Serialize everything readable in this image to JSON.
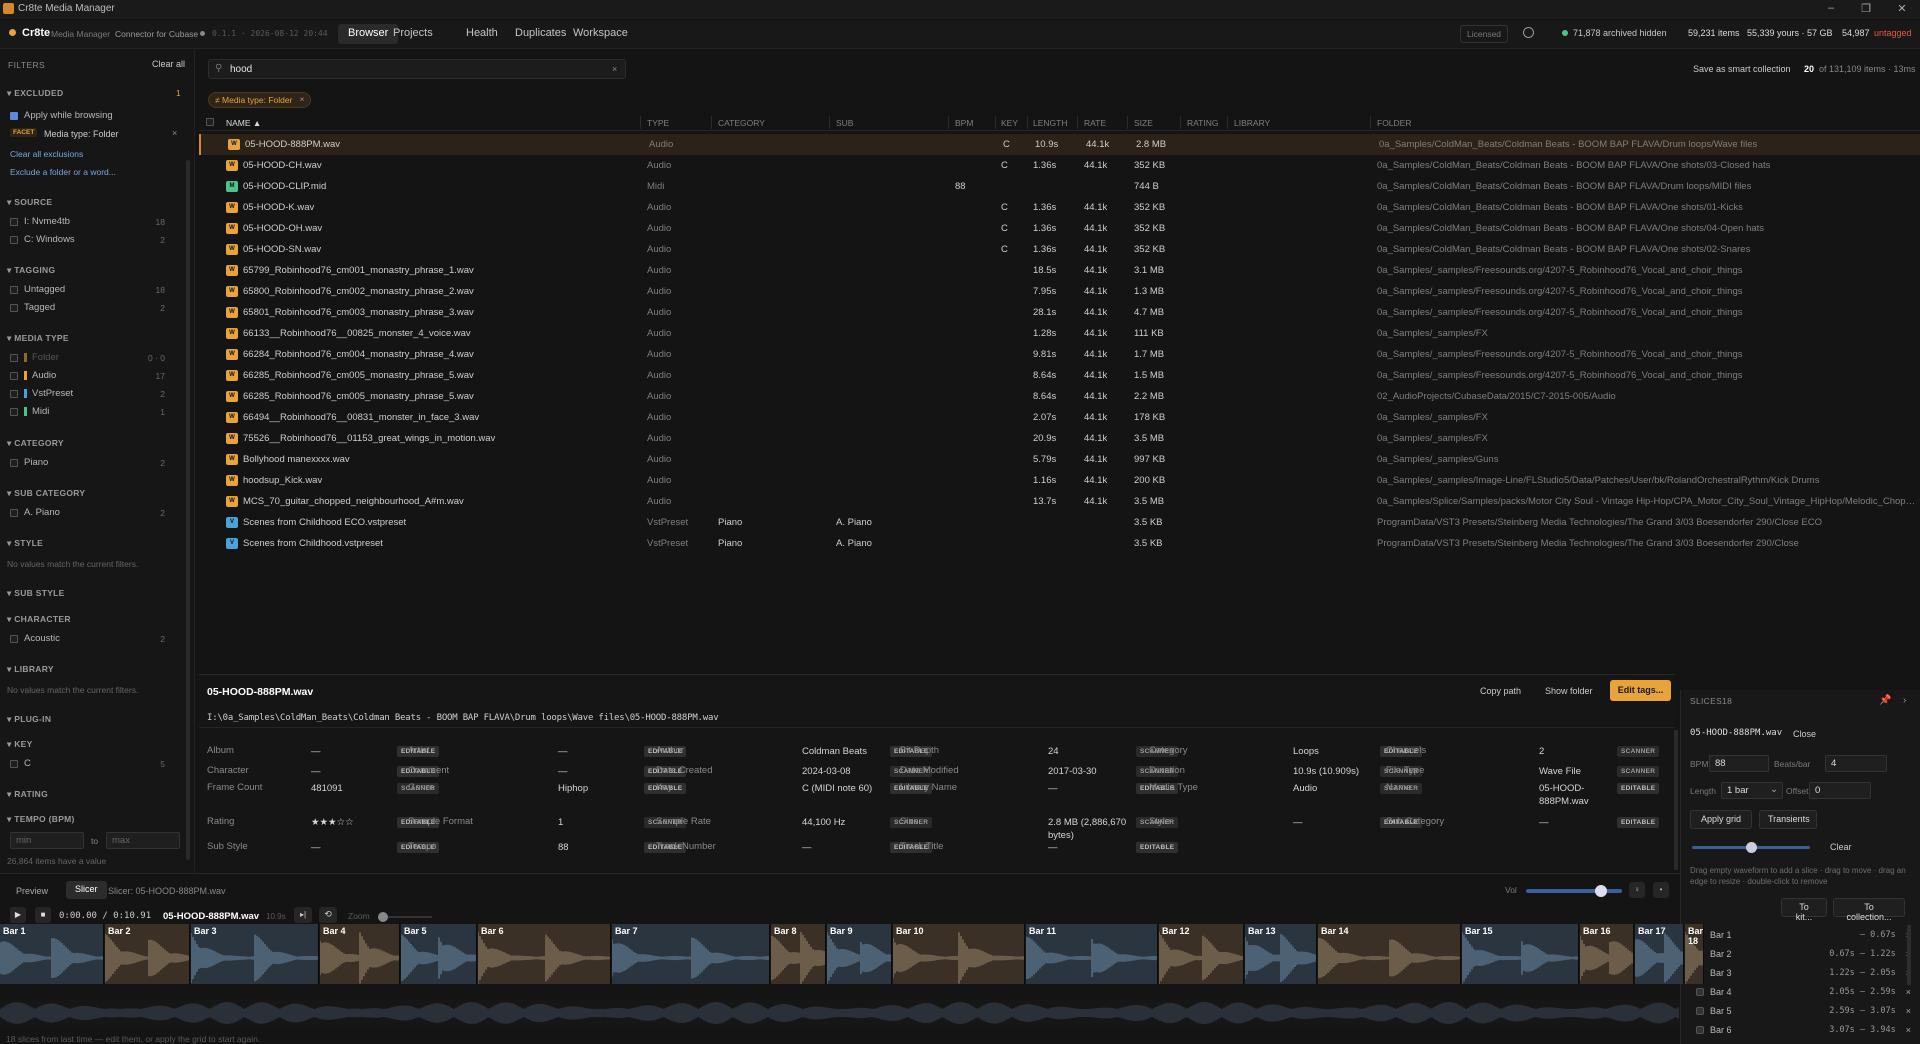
{
  "window": {
    "title": "Cr8te Media Manager"
  },
  "nav": {
    "app": "Cr8te",
    "sub": "Media Manager",
    "connector": "Connector for Cubase",
    "version": "0.1.1 · 2026-08-12 20:44",
    "tabs": [
      "Browser",
      "Projects",
      "Health",
      "Duplicates",
      "Workspace"
    ],
    "licensed": "Licensed",
    "archived": "71,878 archived hidden",
    "items": "59,231 items",
    "yours": "55,339 yours · 57 GB",
    "untagged_count": "54,987",
    "untagged_label": "untagged"
  },
  "filters": {
    "title": "FILTERS",
    "clear_all": "Clear all",
    "excluded": {
      "title": "EXCLUDED",
      "count": "1",
      "apply": "Apply while browsing",
      "facet": "FACET",
      "facet_value": "Media type: Folder",
      "clear": "Clear all exclusions",
      "exclude_hint": "Exclude a folder or a word..."
    },
    "source": {
      "title": "SOURCE",
      "items": [
        {
          "label": "I: Nvme4tb",
          "count": "18"
        },
        {
          "label": "C: Windows",
          "count": "2"
        }
      ]
    },
    "tagging": {
      "title": "TAGGING",
      "items": [
        {
          "label": "Untagged",
          "count": "18"
        },
        {
          "label": "Tagged",
          "count": "2"
        }
      ]
    },
    "media_type": {
      "title": "MEDIA TYPE",
      "items": [
        {
          "label": "Folder",
          "count": "0 · 0",
          "color": "#8a6a2a"
        },
        {
          "label": "Audio",
          "count": "17",
          "color": "#e8a33a"
        },
        {
          "label": "VstPreset",
          "count": "2",
          "color": "#4aa3d8"
        },
        {
          "label": "Midi",
          "count": "1",
          "color": "#4cc38a"
        }
      ]
    },
    "category": {
      "title": "CATEGORY",
      "items": [
        {
          "label": "Piano",
          "count": "2"
        }
      ]
    },
    "sub_category": {
      "title": "SUB CATEGORY",
      "items": [
        {
          "label": "A. Piano",
          "count": "2"
        }
      ]
    },
    "style": {
      "title": "STYLE",
      "empty": "No values match the current filters."
    },
    "sub_style": {
      "title": "SUB STYLE"
    },
    "character": {
      "title": "CHARACTER",
      "items": [
        {
          "label": "Acoustic",
          "count": "2"
        }
      ]
    },
    "library": {
      "title": "LIBRARY",
      "empty": "No values match the current filters."
    },
    "plugin": {
      "title": "PLUG-IN"
    },
    "key": {
      "title": "KEY",
      "items": [
        {
          "label": "C",
          "count": "5"
        }
      ]
    },
    "rating": {
      "title": "RATING"
    },
    "tempo": {
      "title": "TEMPO (BPM)",
      "min": "min",
      "to": "to",
      "max": "max",
      "note": "26,864 items have a value"
    }
  },
  "search": {
    "value": "hood",
    "save": "Save as smart collection",
    "count_a": "20",
    "count_b": "of 131,109 items · 13ms"
  },
  "chip": {
    "label": "≠ Media type: Folder"
  },
  "columns": [
    "Name ▲",
    "Type",
    "Category",
    "Sub",
    "BPM",
    "Key",
    "Length",
    "Rate",
    "Size",
    "Rating",
    "Library",
    "Folder"
  ],
  "rows": [
    {
      "icon": "WAV",
      "c": "#e8a33a",
      "name": "05-HOOD-888PM.wav",
      "type": "Audio",
      "cat": "",
      "sub": "",
      "bpm": "",
      "key": "C",
      "len": "10.9s",
      "rate": "44.1k",
      "size": "2.8 MB",
      "folder": "0a_Samples/ColdMan_Beats/Coldman Beats - BOOM BAP FLAVA/Drum loops/Wave files"
    },
    {
      "icon": "WAV",
      "c": "#e8a33a",
      "name": "05-HOOD-CH.wav",
      "type": "Audio",
      "cat": "",
      "sub": "",
      "bpm": "",
      "key": "C",
      "len": "1.36s",
      "rate": "44.1k",
      "size": "352 KB",
      "folder": "0a_Samples/ColdMan_Beats/Coldman Beats - BOOM BAP FLAVA/One shots/03-Closed hats"
    },
    {
      "icon": "MID",
      "c": "#4cc38a",
      "name": "05-HOOD-CLIP.mid",
      "type": "Midi",
      "cat": "",
      "sub": "",
      "bpm": "88",
      "key": "",
      "len": "",
      "rate": "",
      "size": "744 B",
      "folder": "0a_Samples/ColdMan_Beats/Coldman Beats - BOOM BAP FLAVA/Drum loops/MIDI files"
    },
    {
      "icon": "WAV",
      "c": "#e8a33a",
      "name": "05-HOOD-K.wav",
      "type": "Audio",
      "cat": "",
      "sub": "",
      "bpm": "",
      "key": "C",
      "len": "1.36s",
      "rate": "44.1k",
      "size": "352 KB",
      "folder": "0a_Samples/ColdMan_Beats/Coldman Beats - BOOM BAP FLAVA/One shots/01-Kicks"
    },
    {
      "icon": "WAV",
      "c": "#e8a33a",
      "name": "05-HOOD-OH.wav",
      "type": "Audio",
      "cat": "",
      "sub": "",
      "bpm": "",
      "key": "C",
      "len": "1.36s",
      "rate": "44.1k",
      "size": "352 KB",
      "folder": "0a_Samples/ColdMan_Beats/Coldman Beats - BOOM BAP FLAVA/One shots/04-Open hats"
    },
    {
      "icon": "WAV",
      "c": "#e8a33a",
      "name": "05-HOOD-SN.wav",
      "type": "Audio",
      "cat": "",
      "sub": "",
      "bpm": "",
      "key": "C",
      "len": "1.36s",
      "rate": "44.1k",
      "size": "352 KB",
      "folder": "0a_Samples/ColdMan_Beats/Coldman Beats - BOOM BAP FLAVA/One shots/02-Snares"
    },
    {
      "icon": "WAV",
      "c": "#e8a33a",
      "name": "65799_Robinhood76_cm001_monastry_phrase_1.wav",
      "type": "Audio",
      "cat": "",
      "sub": "",
      "bpm": "",
      "key": "",
      "len": "18.5s",
      "rate": "44.1k",
      "size": "3.1 MB",
      "folder": "0a_Samples/_samples/Freesounds.org/4207-5_Robinhood76_Vocal_and_choir_things"
    },
    {
      "icon": "WAV",
      "c": "#e8a33a",
      "name": "65800_Robinhood76_cm002_monastry_phrase_2.wav",
      "type": "Audio",
      "cat": "",
      "sub": "",
      "bpm": "",
      "key": "",
      "len": "7.95s",
      "rate": "44.1k",
      "size": "1.3 MB",
      "folder": "0a_Samples/_samples/Freesounds.org/4207-5_Robinhood76_Vocal_and_choir_things"
    },
    {
      "icon": "WAV",
      "c": "#e8a33a",
      "name": "65801_Robinhood76_cm003_monastry_phrase_3.wav",
      "type": "Audio",
      "cat": "",
      "sub": "",
      "bpm": "",
      "key": "",
      "len": "28.1s",
      "rate": "44.1k",
      "size": "4.7 MB",
      "folder": "0a_Samples/_samples/Freesounds.org/4207-5_Robinhood76_Vocal_and_choir_things"
    },
    {
      "icon": "WAV",
      "c": "#e8a33a",
      "name": "66133__Robinhood76__00825_monster_4_voice.wav",
      "type": "Audio",
      "cat": "",
      "sub": "",
      "bpm": "",
      "key": "",
      "len": "1.28s",
      "rate": "44.1k",
      "size": "111 KB",
      "folder": "0a_Samples/_samples/FX"
    },
    {
      "icon": "WAV",
      "c": "#e8a33a",
      "name": "66284_Robinhood76_cm004_monastry_phrase_4.wav",
      "type": "Audio",
      "cat": "",
      "sub": "",
      "bpm": "",
      "key": "",
      "len": "9.81s",
      "rate": "44.1k",
      "size": "1.7 MB",
      "folder": "0a_Samples/_samples/Freesounds.org/4207-5_Robinhood76_Vocal_and_choir_things"
    },
    {
      "icon": "WAV",
      "c": "#e8a33a",
      "name": "66285_Robinhood76_cm005_monastry_phrase_5.wav",
      "type": "Audio",
      "cat": "",
      "sub": "",
      "bpm": "",
      "key": "",
      "len": "8.64s",
      "rate": "44.1k",
      "size": "1.5 MB",
      "folder": "0a_Samples/_samples/Freesounds.org/4207-5_Robinhood76_Vocal_and_choir_things"
    },
    {
      "icon": "WAV",
      "c": "#e8a33a",
      "name": "66285_Robinhood76_cm005_monastry_phrase_5.wav",
      "type": "Audio",
      "cat": "",
      "sub": "",
      "bpm": "",
      "key": "",
      "len": "8.64s",
      "rate": "44.1k",
      "size": "2.2 MB",
      "folder": "02_AudioProjects/CubaseData/2015/C7-2015-005/Audio"
    },
    {
      "icon": "WAV",
      "c": "#e8a33a",
      "name": "66494__Robinhood76__00831_monster_in_face_3.wav",
      "type": "Audio",
      "cat": "",
      "sub": "",
      "bpm": "",
      "key": "",
      "len": "2.07s",
      "rate": "44.1k",
      "size": "178 KB",
      "folder": "0a_Samples/_samples/FX"
    },
    {
      "icon": "WAV",
      "c": "#e8a33a",
      "name": "75526__Robinhood76__01153_great_wings_in_motion.wav",
      "type": "Audio",
      "cat": "",
      "sub": "",
      "bpm": "",
      "key": "",
      "len": "20.9s",
      "rate": "44.1k",
      "size": "3.5 MB",
      "folder": "0a_Samples/_samples/FX"
    },
    {
      "icon": "WAV",
      "c": "#e8a33a",
      "name": "Bollyhood manexxxx.wav",
      "type": "Audio",
      "cat": "",
      "sub": "",
      "bpm": "",
      "key": "",
      "len": "5.79s",
      "rate": "44.1k",
      "size": "997 KB",
      "folder": "0a_Samples/_samples/Guns"
    },
    {
      "icon": "WAV",
      "c": "#e8a33a",
      "name": "hoodsup_Kick.wav",
      "type": "Audio",
      "cat": "",
      "sub": "",
      "bpm": "",
      "key": "",
      "len": "1.16s",
      "rate": "44.1k",
      "size": "200 KB",
      "folder": "0a_Samples/_samples/Image-Line/FLStudio5/Data/Patches/User/bk/RolandOrchestralRythm/Kick Drums"
    },
    {
      "icon": "WAV",
      "c": "#e8a33a",
      "name": "MCS_70_guitar_chopped_neighbourhood_A#m.wav",
      "type": "Audio",
      "cat": "",
      "sub": "",
      "bpm": "",
      "key": "",
      "len": "13.7s",
      "rate": "44.1k",
      "size": "3.5 MB",
      "folder": "0a_Samples/Splice/Samples/packs/Motor City Soul - Vintage Hip-Hop/CPA_Motor_City_Soul_Vintage_HipHop/Melodic_Choppe..."
    },
    {
      "icon": "VST",
      "c": "#4aa3d8",
      "name": "Scenes from Childhood ECO.vstpreset",
      "type": "VstPreset",
      "cat": "Piano",
      "sub": "A. Piano",
      "bpm": "",
      "key": "",
      "len": "",
      "rate": "",
      "size": "3.5 KB",
      "folder": "ProgramData/VST3 Presets/Steinberg Media Technologies/The Grand 3/03 Boesendorfer 290/Close ECO"
    },
    {
      "icon": "VST",
      "c": "#4aa3d8",
      "name": "Scenes from Childhood.vstpreset",
      "type": "VstPreset",
      "cat": "Piano",
      "sub": "A. Piano",
      "bpm": "",
      "key": "",
      "len": "",
      "rate": "",
      "size": "3.5 KB",
      "folder": "ProgramData/VST3 Presets/Steinberg Media Technologies/The Grand 3/03 Boesendorfer 290/Close"
    }
  ],
  "details": {
    "title": "05-HOOD-888PM.wav",
    "copy": "Copy path",
    "show": "Show folder",
    "edit": "Edit tags...",
    "path": "I:\\0a_Samples\\ColdMan_Beats\\Coldman Beats - BOOM BAP FLAVA\\Drum loops\\Wave files\\05-HOOD-888PM.wav",
    "fields": [
      [
        {
          "l": "Album",
          "v": "—",
          "b": "EDITABLE"
        },
        {
          "l": "Artist",
          "v": "—",
          "b": "EDITABLE"
        },
        {
          "l": "Author",
          "v": "Coldman Beats",
          "b": "EDITABLE"
        },
        {
          "l": "Bit Depth",
          "v": "24",
          "b": "SCANNER"
        },
        {
          "l": "Category",
          "v": "Loops",
          "b": "EDITABLE"
        },
        {
          "l": "Channels",
          "v": "2",
          "b": "SCANNER"
        }
      ],
      [
        {
          "l": "Character",
          "v": "—",
          "b": "EDITABLE"
        },
        {
          "l": "Comment",
          "v": "—",
          "b": "EDITABLE"
        },
        {
          "l": "Date Created",
          "v": "2024-03-08",
          "b": "SCANNER"
        },
        {
          "l": "Date Modified",
          "v": "2017-03-30",
          "b": "SCANNER"
        },
        {
          "l": "Duration",
          "v": "10.9s (10.909s)",
          "b": "SCANNER"
        },
        {
          "l": "File Type",
          "v": "Wave File",
          "b": "SCANNER"
        }
      ],
      [
        {
          "l": "Frame Count",
          "v": "481091",
          "b": "SCANNER"
        },
        {
          "l": "Genre",
          "v": "Hiphop",
          "b": "EDITABLE"
        },
        {
          "l": "Key",
          "v": "C (MIDI note 60)",
          "b": "EDITABLE"
        },
        {
          "l": "Library Name",
          "v": "—",
          "b": "EDITABLE"
        },
        {
          "l": "Media Type",
          "v": "Audio",
          "b": "SCANNER"
        },
        {
          "l": "Name",
          "v": "05-HOOD-888PM.wav",
          "b": "EDITABLE"
        }
      ],
      [
        {
          "l": "Rating",
          "v": "★★★☆☆",
          "b": "EDITABLE"
        },
        {
          "l": "Sample Format",
          "v": "1",
          "b": "SCANNER"
        },
        {
          "l": "Sample Rate",
          "v": "44,100 Hz",
          "b": "SCANNER"
        },
        {
          "l": "Size",
          "v": "2.8 MB (2,886,670 bytes)",
          "b": "SCANNER"
        },
        {
          "l": "Style",
          "v": "—",
          "b": "EDITABLE"
        },
        {
          "l": "Sub Category",
          "v": "—",
          "b": "EDITABLE"
        }
      ],
      [
        {
          "l": "Sub Style",
          "v": "—",
          "b": "EDITABLE"
        },
        {
          "l": "Tempo",
          "v": "88",
          "b": "EDITABLE"
        },
        {
          "l": "Track Number",
          "v": "—",
          "b": "EDITABLE"
        },
        {
          "l": "Track Title",
          "v": "—",
          "b": "EDITABLE"
        }
      ]
    ]
  },
  "player": {
    "tab_preview": "Preview",
    "tab_slicer": "Slicer",
    "slicer_label": "Slicer: 05-HOOD-888PM.wav",
    "time": "0:00.00 / 0:10.91",
    "file": "05-HOOD-888PM.wav",
    "dur": "10.9s",
    "zoom": "Zoom",
    "vol": "Vol",
    "volume_level": 0.78,
    "zoom_level": 0.0,
    "bars": [
      "Bar 1",
      "Bar 2",
      "Bar 3",
      "Bar 4",
      "Bar 5",
      "Bar 6",
      "Bar 7",
      "Bar 8",
      "Bar 9",
      "Bar 10",
      "Bar 11",
      "Bar 12",
      "Bar 13",
      "Bar 14",
      "Bar 15",
      "Bar 16",
      "Bar 17",
      "Bar 18"
    ],
    "status": "18 slices from last time — edit them, or apply the grid to start again."
  },
  "slices": {
    "title": "SLICES",
    "count": "18",
    "file": "05-HOOD-888PM.wav",
    "close": "Close",
    "bpm_l": "BPM",
    "bpm": "88",
    "bpb_l": "Beats/bar",
    "bpb": "4",
    "len_l": "Length",
    "len": "1 bar",
    "off_l": "Offset",
    "off": "0",
    "apply": "Apply grid",
    "transients": "Transients",
    "clear": "Clear",
    "help": "Drag empty waveform to add a slice · drag to move · drag an edge to resize · double-click to remove",
    "kit": "To kit...",
    "coll": "To collection...",
    "threshold_level": 0.5,
    "list": [
      {
        "n": "Bar 1",
        "r": "— 0.67s"
      },
      {
        "n": "Bar 2",
        "r": "0.67s — 1.22s"
      },
      {
        "n": "Bar 3",
        "r": "1.22s — 2.05s"
      },
      {
        "n": "Bar 4",
        "r": "2.05s — 2.59s"
      },
      {
        "n": "Bar 5",
        "r": "2.59s — 3.07s"
      },
      {
        "n": "Bar 6",
        "r": "3.07s — 3.94s"
      }
    ]
  },
  "colors": {
    "accent": "#e8a33a",
    "brown": "#3a3025",
    "blue": "#2a3540"
  }
}
